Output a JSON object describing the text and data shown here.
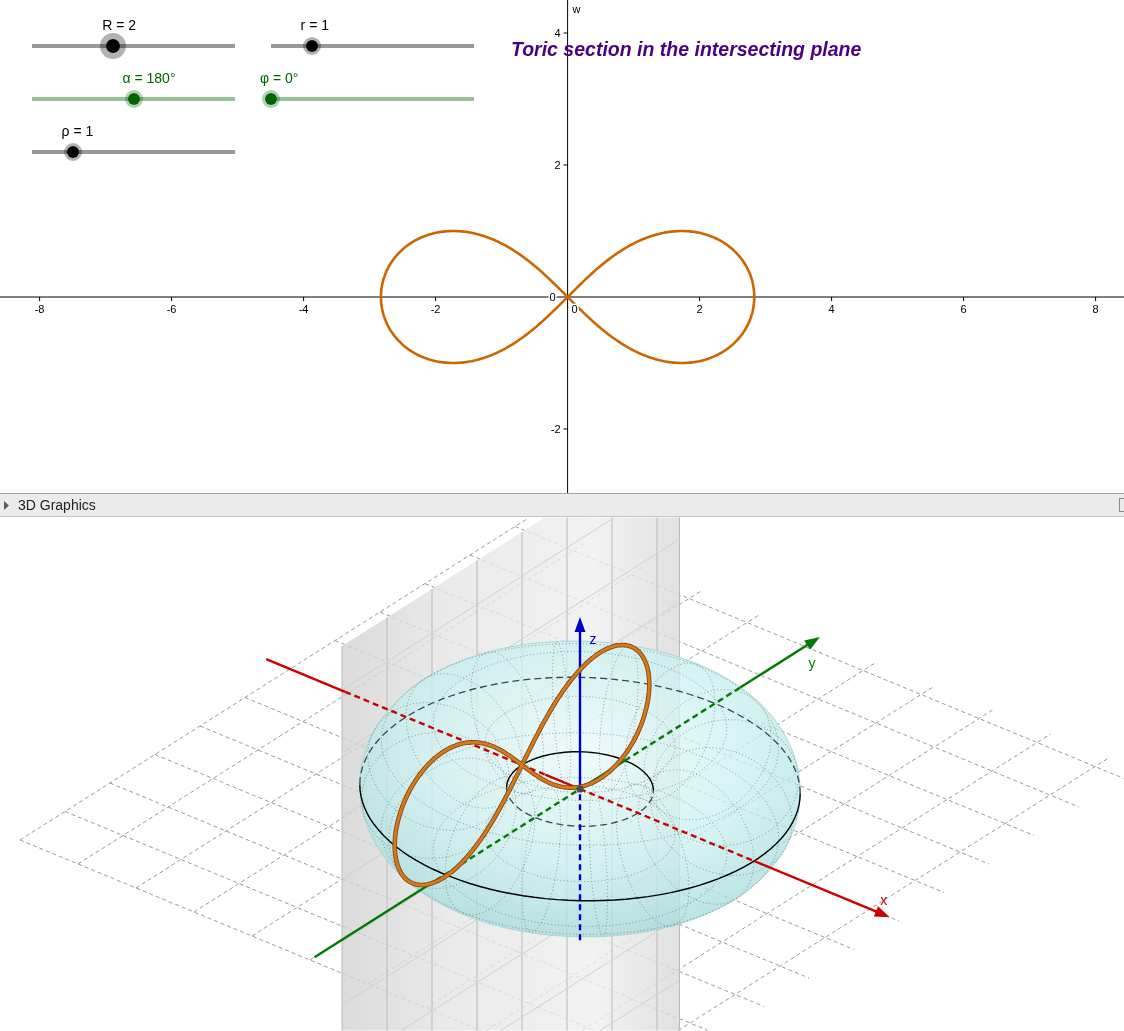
{
  "graphics_2d": {
    "sliders": [
      {
        "label": "R = 2",
        "level": 0.4,
        "color": "#000000",
        "selected": true
      },
      {
        "label": "r = 1",
        "level": 0.2,
        "color": "#000000",
        "selected": false
      },
      {
        "label": "α = 180°",
        "level": 0.5,
        "color": "#006400",
        "selected": false
      },
      {
        "label": "φ = 0°",
        "level": 0,
        "color": "#006400",
        "selected": false
      },
      {
        "label": "ρ = 1",
        "level": 0.2,
        "color": "#000000",
        "selected": false
      }
    ],
    "heading": "Toric section in the intersecting plane",
    "chart_data": {
      "type": "line",
      "ylabel": "w",
      "xlim": [
        -8.6,
        8.43
      ],
      "ylim": [
        -2.97,
        4.5
      ],
      "xticks": [
        -8,
        -6,
        -4,
        -2,
        0,
        2,
        4,
        6,
        8
      ],
      "yticks": [
        -2,
        0,
        2,
        4
      ]
    }
  },
  "graphics_3d": {
    "title": "3D Graphics",
    "axes": [
      {
        "label": "x",
        "color": "#cc0000"
      },
      {
        "label": "y",
        "color": "#007a00"
      },
      {
        "label": "z",
        "color": "#0000cc"
      }
    ]
  }
}
